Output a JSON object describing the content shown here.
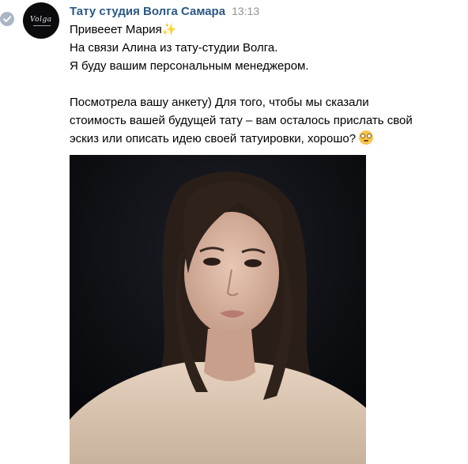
{
  "message": {
    "author": "Тату студия Волга Самара",
    "time": "13:13",
    "avatar_logo": "Volga",
    "lines": [
      "Привееет Мария",
      "На связи Алина из тату-студии Волга.",
      "Я буду вашим персональным менеджером.",
      "",
      "Посмотрела вашу анкету) Для того, чтобы мы сказали",
      "стоимость вашей будущей тату – вам осталось прислать свой",
      "эскиз или описать идею своей татуировки, хорошо?"
    ],
    "emoji": {
      "sparkles": "✨",
      "flushed": "flushed-face-emoji"
    },
    "attachment": {
      "type": "photo",
      "description_icon": "photo-of-woman"
    }
  },
  "colors": {
    "author": "#2a5885",
    "time": "#939393",
    "check_badge": "#aab6c4"
  }
}
